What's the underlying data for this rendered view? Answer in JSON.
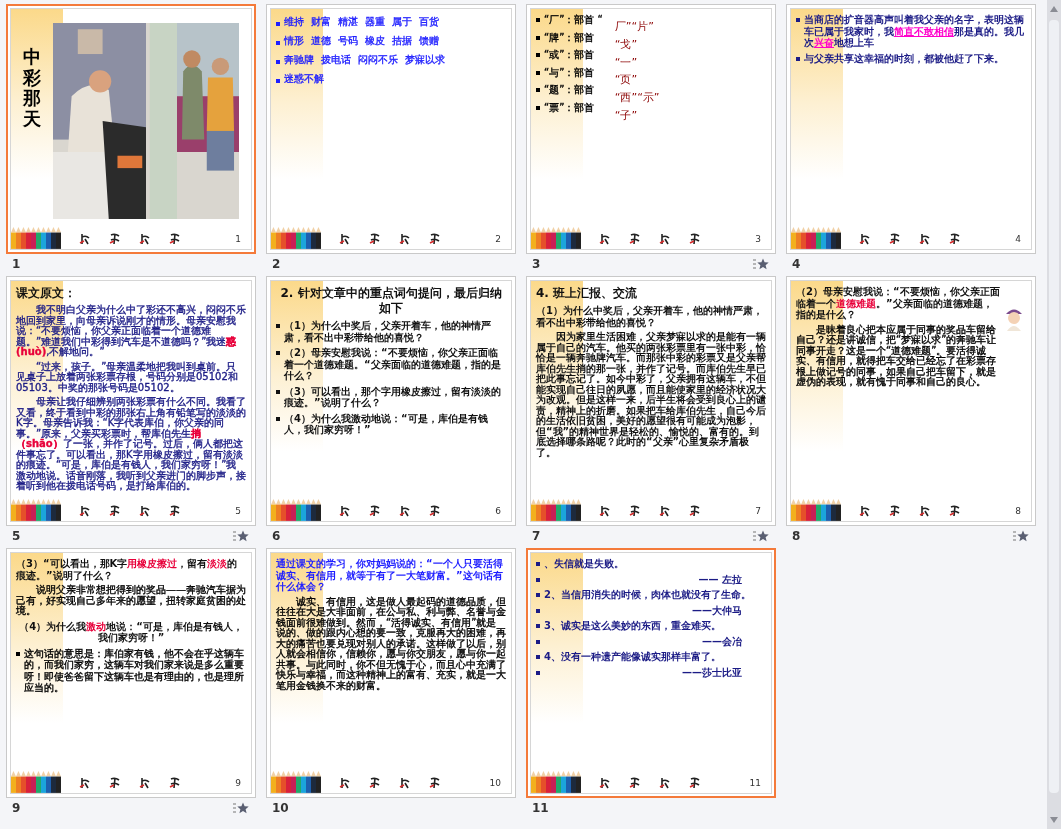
{
  "slides": [
    {
      "number": "1",
      "selected": true,
      "transition": false,
      "kind": "cover",
      "title": "中彩那天",
      "page": "1"
    },
    {
      "number": "2",
      "selected": false,
      "transition": false,
      "kind": "content",
      "page": "2",
      "blocks": [
        {
          "kind": "word_line",
          "color": "#1f1fff",
          "words": [
            "维持",
            "财富",
            "精湛",
            "器重",
            "属于",
            "百货"
          ]
        },
        {
          "kind": "word_line",
          "color": "#1f1fff",
          "words": [
            "情形",
            "道德",
            "号码",
            "橡皮",
            "拮据",
            "馈赠"
          ]
        },
        {
          "kind": "word_line",
          "color": "#1f1fff",
          "words": [
            "奔驰牌",
            "拨电话",
            "闷闷不乐",
            "梦寐以求"
          ]
        },
        {
          "kind": "word_line",
          "color": "#1f1fff",
          "words": [
            "迷惑不解"
          ]
        }
      ]
    },
    {
      "number": "3",
      "selected": false,
      "transition": true,
      "kind": "content",
      "page": "3",
      "blocks": [
        {
          "kind": "radical_table",
          "color": "#000000",
          "items": [
            "“厂”：部首 “",
            "“牌”：部首",
            "“或”：部首",
            "“与”：部首",
            "“题”：部首",
            "“票”：部首"
          ],
          "radicals": [
            "厂”“片”",
            "“戈”",
            "“一”",
            "“页”",
            "“西”“示”",
            "“子”"
          ]
        }
      ]
    },
    {
      "number": "4",
      "selected": false,
      "transition": false,
      "kind": "content",
      "page": "4",
      "blocks": [
        {
          "kind": "bullet",
          "color": "#1c1c86",
          "bold": true,
          "parts": [
            {
              "text": "当商店的扩音器高声叫着我父亲的名字，表明这辆车已属于我家时，我"
            },
            {
              "text": "简直不敢相信",
              "color": "#ff00cc",
              "underlined": true
            },
            {
              "text": "那是真的。我几次"
            },
            {
              "text": "兴奋",
              "color": "#ff00cc",
              "underlined": true
            },
            {
              "text": "地想上车"
            }
          ]
        },
        {
          "kind": "bullet",
          "color": "#1c1c86",
          "bold": true,
          "parts": [
            {
              "text": "与父亲共享这幸福的时刻，都被他赶了下来。"
            }
          ]
        }
      ]
    },
    {
      "number": "5",
      "selected": false,
      "transition": true,
      "kind": "content",
      "page": "5",
      "blocks": [
        {
          "kind": "title",
          "color": "#111111",
          "parts": [
            {
              "text": "课文原文："
            }
          ]
        },
        {
          "kind": "para",
          "color": "#1c1c86",
          "parts": [
            {
              "text": "我不明白父亲为什么中了彩还不高兴，闷闷不乐地回到家里，向母亲诉说刚才的情形。母亲安慰我说：“不要烦恼，你父亲正面临着一个道德难题。”难道我们中彩得到汽车是不道德吗？”我迷"
            },
            {
              "text": "惑(huò)",
              "color": "#e8003a"
            },
            {
              "text": ",不解地问。”"
            }
          ]
        },
        {
          "kind": "para",
          "color": "#1c1c86",
          "parts": [
            {
              "text": "“过来，孩子。”母亲温柔地把我叫到桌前。只见桌子上放着两张彩票存根，号码分别是05102和05103。中奖的那张号码是05102。"
            }
          ]
        },
        {
          "kind": "para",
          "color": "#1c1c86",
          "parts": [
            {
              "text": "母亲让我仔细辨别两张彩票有什么不同。我看了又看，终于看到中彩的那张右上角有铅笔写的淡淡的K字。母亲告诉我：“K字代表库伯，你父亲的同事。”原来，父亲买彩票时，帮库伯先生"
            },
            {
              "text": "捎（shāo）",
              "color": "#e8003a"
            },
            {
              "text": "了一张，并作了记号。过后，俩人都把这件事忘了。可以看出，那K字用橡皮擦过，留有淡淡的痕迹。“可是，库伯是有钱人，我们家穷呀！”我激动地说。话音刚落，我听到父亲进门的脚步声，接着听到他在拨电话号码，是打给库伯的。"
            }
          ]
        }
      ]
    },
    {
      "number": "6",
      "selected": false,
      "transition": false,
      "kind": "content",
      "page": "6",
      "blocks": [
        {
          "kind": "title",
          "color": "#111111",
          "centered": true,
          "parts": [
            {
              "text": "2. 针对文章中的重点词句提问，最后归纳如下"
            }
          ]
        },
        {
          "kind": "bullet",
          "color": "#111111",
          "bold": true,
          "parts": [
            {
              "text": "（1）为什么中奖后，父亲开着车，他的神情严肃，看不出中彩带给他的喜悦？"
            }
          ]
        },
        {
          "kind": "bullet",
          "color": "#111111",
          "bold": true,
          "parts": [
            {
              "text": "（2）母亲安慰我说：“不要烦恼，你父亲正面临着一个道德难题。“父亲面临的道德难题，指的是什么？"
            }
          ]
        },
        {
          "kind": "bullet",
          "color": "#111111",
          "bold": true,
          "parts": [
            {
              "text": "（3）可以看出，那个字用橡皮擦过，留有淡淡的痕迹。”说明了什么？"
            }
          ]
        },
        {
          "kind": "bullet",
          "color": "#111111",
          "bold": true,
          "parts": [
            {
              "text": "（4）为什么我激动地说：“可是，库伯是有钱人，我们家穷呀！”"
            }
          ]
        }
      ]
    },
    {
      "number": "7",
      "selected": false,
      "transition": true,
      "kind": "content",
      "page": "7",
      "blocks": [
        {
          "kind": "title",
          "color": "#111111",
          "parts": [
            {
              "text": "4. 班上汇报、交流"
            }
          ]
        },
        {
          "kind": "heading",
          "color": "#111111",
          "parts": [
            {
              "text": "（1）为什么中奖后，父亲开着车，他的神情严肃，看不出中彩带给他的喜悦？"
            }
          ]
        },
        {
          "kind": "para",
          "color": "#111111",
          "bold": true,
          "parts": [
            {
              "text": "因为家里生活困难，父亲梦寐以求的是能有一辆属于自己的汽车。他买的两张彩票里有一张中彩，恰恰是一辆奔驰牌汽车。而那张中彩的彩票又是父亲帮库伯先生捎的那一张，并作了记号。而库伯先生早已把此事忘记了。如今中彩了，父亲拥有这辆车，不但能实现自己往日的夙愿，而且能使家里的经济状况大为改观。但是这样一来，后半生将会受到良心上的谴责，精神上的折磨。如果把车给库伯先生，自己今后的生活依旧贫困，美好的愿望很有可能成为泡影，但“我”的精神世界是轻松的、愉悦的、富有的。到底选择哪条路呢？此时的“父亲”心里复杂矛盾极了。"
            }
          ]
        }
      ]
    },
    {
      "number": "8",
      "selected": false,
      "transition": true,
      "kind": "content",
      "page": "8",
      "avatar": true,
      "blocks": [
        {
          "kind": "heading",
          "color": "#111111",
          "parts": [
            {
              "text": "（2）母亲安慰我说：“不要烦恼，你父亲正面临着一个"
            },
            {
              "text": "道德难题",
              "color": "#e8003a"
            },
            {
              "text": "。”父亲面临的道德难题，指的是什么？"
            }
          ]
        },
        {
          "kind": "para",
          "color": "#000000",
          "parts": [
            {
              "text": "是昧着良心把本应属于同事的奖品车留给自己？还是讲诚信，把“梦寐以求”的奔驰车让同事开走？这是一个“道德难题”。要活得诚实、有信用，就得把车交给已经忘了在彩票存根上做记号的同事，如果自己把车留下，就是虚伪的表现，就有愧于同事和自己的良心。"
            }
          ]
        }
      ]
    },
    {
      "number": "9",
      "selected": false,
      "transition": true,
      "kind": "content",
      "page": "9",
      "blocks": [
        {
          "kind": "heading",
          "color": "#111111",
          "parts": [
            {
              "text": "（3）“可以看出，那K字"
            },
            {
              "text": "用橡皮擦过",
              "color": "#e8003a"
            },
            {
              "text": "，留有"
            },
            {
              "text": "淡淡",
              "color": "#e8003a"
            },
            {
              "text": "的痕迹。”说明了什么？"
            }
          ]
        },
        {
          "kind": "para",
          "color": "#000000",
          "parts": [
            {
              "text": "说明父亲非常想把得到的奖品——奔驰汽车据为己有，好实现自己多年来的愿望，扭转家庭贫困的处境。"
            }
          ]
        },
        {
          "kind": "heading",
          "color": "#111111",
          "centered": true,
          "parts": [
            {
              "text": "（4）为什么我"
            },
            {
              "text": "激动",
              "color": "#e8003a"
            },
            {
              "text": "地说：“可是，库伯是有钱人，我们家穷呀！”"
            }
          ]
        },
        {
          "kind": "bullet",
          "color": "#000000",
          "parts": [
            {
              "text": "这句话的意思是：库伯家有钱，他不会在乎这辆车的，而我们家穷，这辆车对我们家来说是多么重要呀！即使爸爸留下这辆车也是有理由的，也是理所应当的。"
            }
          ]
        }
      ]
    },
    {
      "number": "10",
      "selected": false,
      "transition": false,
      "kind": "content",
      "page": "10",
      "blocks": [
        {
          "kind": "heading",
          "color": "#1f1fff",
          "parts": [
            {
              "text": "通过课文的学习，你对妈妈说的：“一个人只要活得诚实、有信用，就等于有了一大笔财富。”这句话有什么体会？"
            }
          ]
        },
        {
          "kind": "para",
          "color": "#000000",
          "parts": [
            {
              "text": "诚实、有信用，这是做人最起码的道德品质，但往往在大是大非面前，在公与私、利与弊、名誉与金钱面前很难做到。然而，“活得诚实、有信用”就是说的、做的跟内心想的要一致，克服再大的困难，再大的痛苦也要兑现对别人的承诺。这样做了以后，别人就会相信你，信赖你，愿与你交朋友，愿与你一起共事。与此同时，你不但无愧于心，而且心中充满了快乐与幸福，而这种精神上的富有、充实，就是一大笔用金钱换不来的财富。"
            }
          ]
        }
      ]
    },
    {
      "number": "11",
      "selected": true,
      "transition": false,
      "kind": "content",
      "page": "11",
      "blocks": [
        {
          "kind": "bullet",
          "color": "#1c1c86",
          "bold": true,
          "parts": [
            {
              "text": "、失信就是失败。"
            }
          ]
        },
        {
          "kind": "attribution",
          "color": "#1c1c86",
          "parts": [
            {
              "text": "—— 左拉"
            }
          ]
        },
        {
          "kind": "bullet",
          "color": "#1c1c86",
          "bold": true,
          "parts": [
            {
              "text": "2、当信用消失的时候，肉体也就没有了生命。"
            }
          ]
        },
        {
          "kind": "attribution",
          "color": "#1c1c86",
          "parts": [
            {
              "text": "——大仲马"
            }
          ]
        },
        {
          "kind": "bullet",
          "color": "#1c1c86",
          "bold": true,
          "parts": [
            {
              "text": "3、诚实是这么美妙的东西，重金难买。"
            }
          ]
        },
        {
          "kind": "attribution",
          "color": "#1c1c86",
          "parts": [
            {
              "text": "——会冶"
            }
          ]
        },
        {
          "kind": "bullet",
          "color": "#1c1c86",
          "bold": true,
          "parts": [
            {
              "text": "4、没有一种遗产能像诚实那样丰富了。"
            }
          ]
        },
        {
          "kind": "attribution",
          "color": "#1c1c86",
          "parts": [
            {
              "text": "——莎士比亚"
            }
          ]
        }
      ]
    }
  ]
}
